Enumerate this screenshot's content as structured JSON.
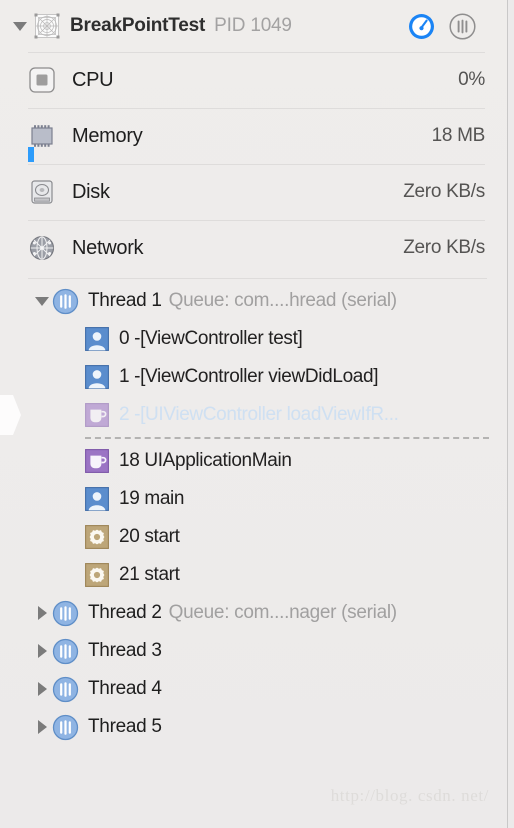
{
  "header": {
    "app_name": "BreakPointTest",
    "pid_label": "PID 1049",
    "app_icon": "app-template-icon",
    "disclosure": "disclosure-triangle-expanded",
    "buttons": [
      {
        "name": "gauges-view-button",
        "icon": "gauge-icon",
        "active": true
      },
      {
        "name": "threads-view-button",
        "icon": "threads-icon",
        "active": false
      }
    ]
  },
  "gauges": [
    {
      "icon": "cpu-chip-icon",
      "label": "CPU",
      "value": "0%"
    },
    {
      "icon": "memory-chip-icon",
      "label": "Memory",
      "value": "18 MB"
    },
    {
      "icon": "disk-drive-icon",
      "label": "Disk",
      "value": "Zero KB/s"
    },
    {
      "icon": "network-globe-icon",
      "label": "Network",
      "value": "Zero KB/s"
    }
  ],
  "threads": [
    {
      "expanded": true,
      "icon": "thread-icon",
      "title": "Thread 1",
      "queue": "Queue: com....hread (serial)",
      "frames": [
        {
          "icon": "user-frame-icon",
          "label": "0 -[ViewController test]",
          "dimmed": false
        },
        {
          "icon": "user-frame-icon",
          "label": "1 -[ViewController viewDidLoad]",
          "dimmed": false
        },
        {
          "icon": "system-frame-icon",
          "label": "2 -[UIViewController loadViewIfR...",
          "dimmed": true
        },
        {
          "icon": "system-frame-icon",
          "label": "18 UIApplicationMain",
          "dimmed": false
        },
        {
          "icon": "user-frame-icon",
          "label": "19 main",
          "dimmed": false
        },
        {
          "icon": "gear-frame-icon",
          "label": "20 start",
          "dimmed": false
        },
        {
          "icon": "gear-frame-icon",
          "label": "21 start",
          "dimmed": false
        }
      ]
    },
    {
      "expanded": false,
      "icon": "thread-icon",
      "title": "Thread 2",
      "queue": "Queue: com....nager (serial)",
      "frames": []
    },
    {
      "expanded": false,
      "icon": "thread-icon",
      "title": "Thread 3",
      "queue": "",
      "frames": []
    },
    {
      "expanded": false,
      "icon": "thread-icon",
      "title": "Thread 4",
      "queue": "",
      "frames": []
    },
    {
      "expanded": false,
      "icon": "thread-icon",
      "title": "Thread 5",
      "queue": "",
      "frames": []
    }
  ],
  "watermark": "http://blog. csdn. net/",
  "colors": {
    "panel_bg": "#eeeceb",
    "accent_blue": "#1a84f5",
    "thread_icon_blue": "#6f9fdc",
    "user_frame_blue": "#5b8dcd",
    "system_frame_purple": "#9b74c4",
    "gear_frame_tan": "#bda679",
    "memory_bar": "#2d9cfb",
    "dim_text": "#cfe0f2",
    "secondary_text": "#a1a0a0"
  }
}
